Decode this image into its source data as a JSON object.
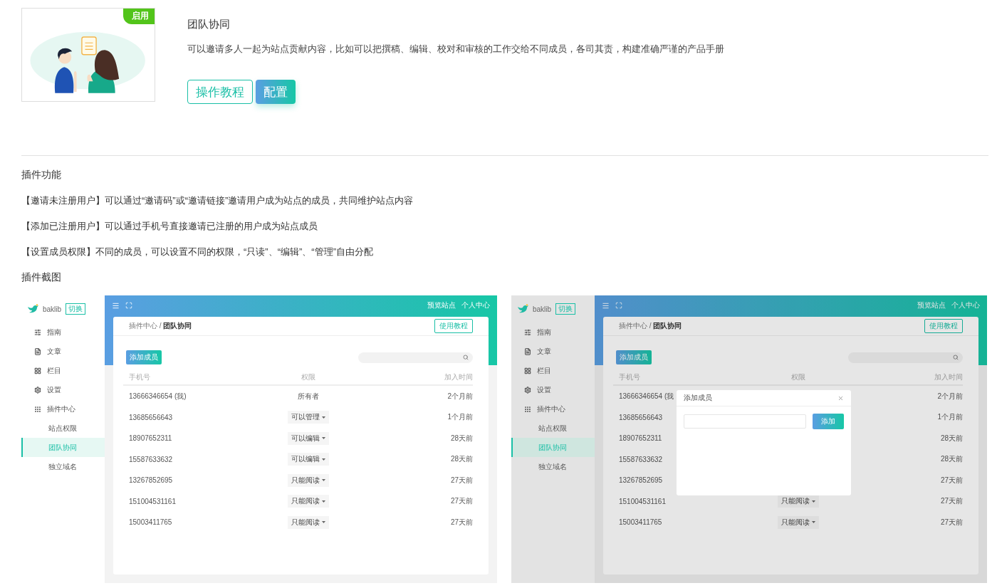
{
  "plugin": {
    "badge": "启用",
    "title": "团队协同",
    "description": "可以邀请多人一起为站点贡献内容，比如可以把撰稿、编辑、校对和审核的工作交给不同成员，各司其责，构建准确严谨的产品手册",
    "buttons": [
      {
        "label": "操作教程",
        "kind": "outline"
      },
      {
        "label": "配置",
        "kind": "primary"
      }
    ]
  },
  "features": {
    "heading": "插件功能",
    "items": [
      "【邀请未注册用户】可以通过“邀请码”或“邀请链接”邀请用户成为站点的成员，共同维护站点内容",
      "【添加已注册用户】可以通过手机号直接邀请已注册的用户成为站点成员",
      "【设置成员权限】不同的成员，可以设置不同的权限，“只读”、“编辑”、“管理”自由分配"
    ]
  },
  "screenshots": {
    "heading": "插件截图",
    "items": [
      {
        "dimmed": false,
        "brand": "baklib",
        "switch": "切换",
        "nav": [
          {
            "label": "指南",
            "selected": false
          },
          {
            "label": "文章",
            "selected": false
          },
          {
            "label": "栏目",
            "selected": false
          },
          {
            "label": "设置",
            "selected": false
          },
          {
            "label": "插件中心",
            "selected": false,
            "children": [
              {
                "label": "站点权限",
                "selected": false
              },
              {
                "label": "团队协同",
                "selected": true
              },
              {
                "label": "独立域名",
                "selected": false
              }
            ]
          }
        ],
        "top_links": [
          "预览站点",
          "个人中心"
        ],
        "breadcrumb": "插件中心 / **团队协同**",
        "help_button": "使用教程",
        "add_button": "添加成员",
        "columns": [
          "手机号",
          "权限",
          "加入时间"
        ],
        "rows": [
          {
            "phone": "13666346654 (我)",
            "permission": "所有者",
            "kind": "text",
            "joined": "2个月前"
          },
          {
            "phone": "13685656643",
            "permission": "可以管理",
            "kind": "select",
            "joined": "1个月前"
          },
          {
            "phone": "18907652311",
            "permission": "可以编辑",
            "kind": "select",
            "joined": "28天前"
          },
          {
            "phone": "15587633632",
            "permission": "可以编辑",
            "kind": "select",
            "joined": "28天前"
          },
          {
            "phone": "13267852695",
            "permission": "只能阅读",
            "kind": "select",
            "joined": "27天前"
          },
          {
            "phone": "151004531161",
            "permission": "只能阅读",
            "kind": "select",
            "joined": "27天前"
          },
          {
            "phone": "15003411765",
            "permission": "只能阅读",
            "kind": "select",
            "joined": "27天前"
          }
        ]
      },
      {
        "dimmed": true,
        "brand": "baklib",
        "switch": "切换",
        "nav": [
          {
            "label": "指南",
            "selected": false
          },
          {
            "label": "文章",
            "selected": false
          },
          {
            "label": "栏目",
            "selected": false
          },
          {
            "label": "设置",
            "selected": false
          },
          {
            "label": "插件中心",
            "selected": false,
            "children": [
              {
                "label": "站点权限",
                "selected": false
              },
              {
                "label": "团队协同",
                "selected": true
              },
              {
                "label": "独立域名",
                "selected": false
              }
            ]
          }
        ],
        "top_links": [
          "预览站点",
          "个人中心"
        ],
        "breadcrumb": "插件中心 / **团队协同**",
        "help_button": "使用教程",
        "add_button": "添加成员",
        "columns": [
          "手机号",
          "权限",
          "加入时间"
        ],
        "rows": [
          {
            "phone": "13666346654 (我",
            "kind": "hidden",
            "joined": "2个月前"
          },
          {
            "phone": "13685656643",
            "kind": "hidden",
            "joined": "1个月前"
          },
          {
            "phone": "18907652311",
            "kind": "hidden",
            "joined": "28天前"
          },
          {
            "phone": "15587633632",
            "kind": "hidden",
            "joined": "28天前"
          },
          {
            "phone": "13267852695",
            "kind": "hidden",
            "joined": "27天前"
          },
          {
            "phone": "151004531161",
            "permission": "只能阅读",
            "kind": "select",
            "joined": "27天前"
          },
          {
            "phone": "15003411765",
            "permission": "只能阅读",
            "kind": "select",
            "joined": "27天前"
          }
        ],
        "modal": {
          "title": "添加成员",
          "button": "添加"
        }
      }
    ]
  }
}
